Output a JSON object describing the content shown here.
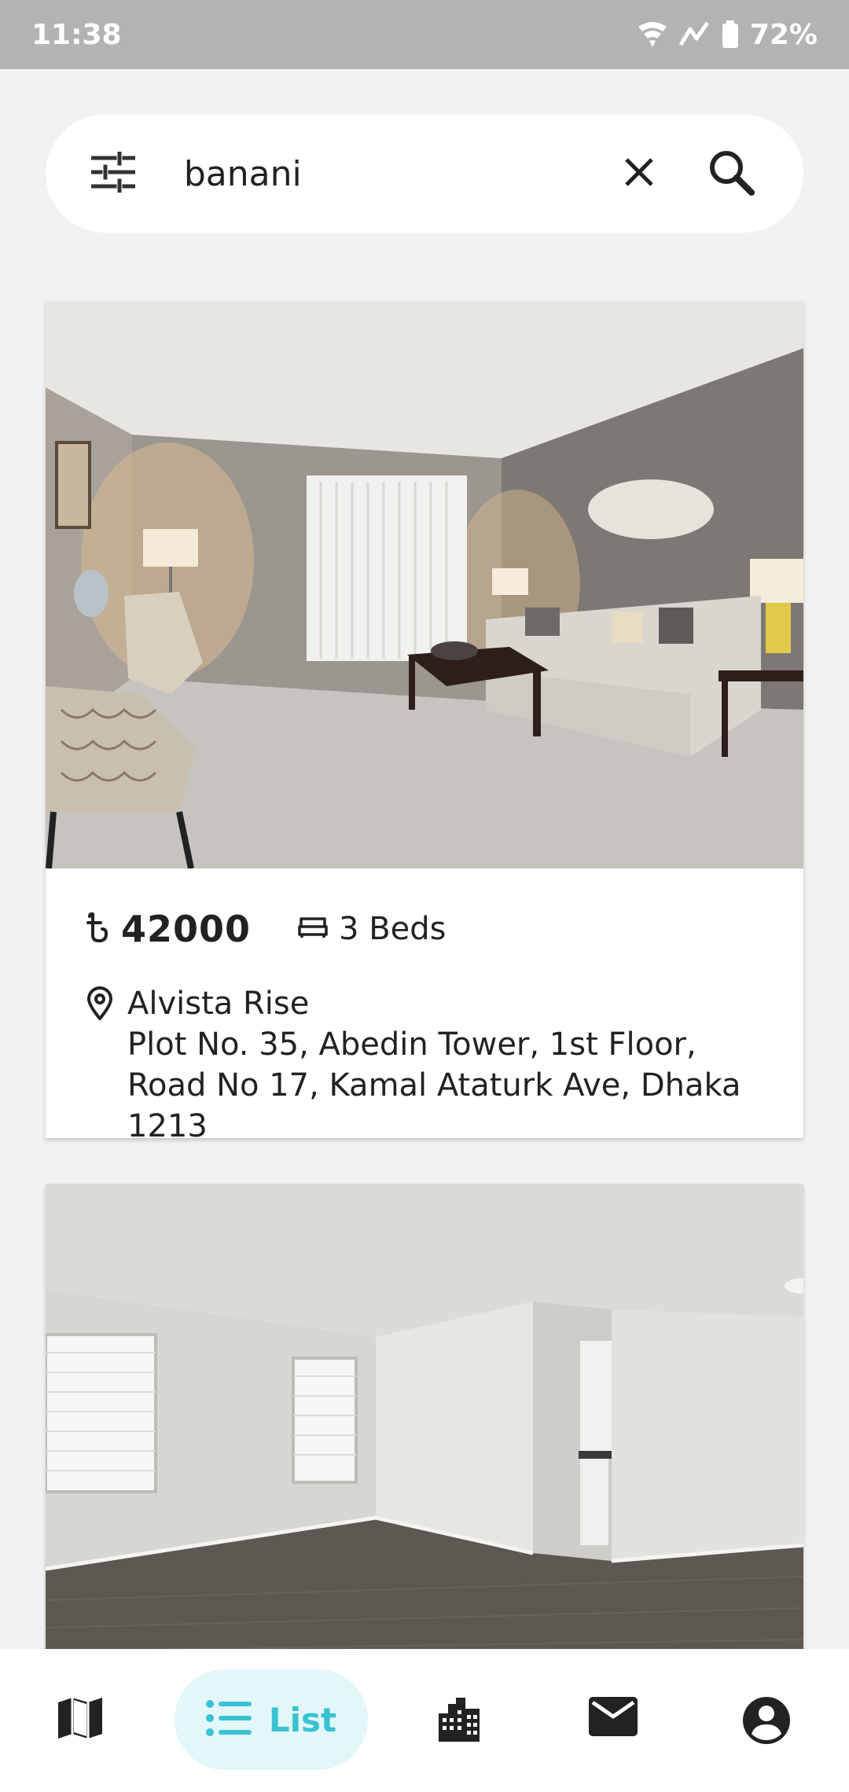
{
  "status_bar": {
    "time": "11:38",
    "battery": "72%"
  },
  "search": {
    "query": "banani",
    "placeholder": ""
  },
  "listings": [
    {
      "price": "42000",
      "beds": "3 Beds",
      "name": "Alvista Rise",
      "address": "Plot No. 35, Abedin Tower, 1st Floor, Road No 17, Kamal Ataturk Ave, Dhaka 1213"
    }
  ],
  "bottom_nav": {
    "items": [
      {
        "icon": "map-icon",
        "label": ""
      },
      {
        "icon": "list-icon",
        "label": "List",
        "active": true
      },
      {
        "icon": "buildings-icon",
        "label": ""
      },
      {
        "icon": "mail-icon",
        "label": ""
      },
      {
        "icon": "profile-icon",
        "label": ""
      }
    ]
  },
  "colors": {
    "accent": "#39c3d2",
    "accent_bg": "#e3f6f8",
    "status_bar": "#b3b3b3",
    "background": "#f2f2f2"
  }
}
